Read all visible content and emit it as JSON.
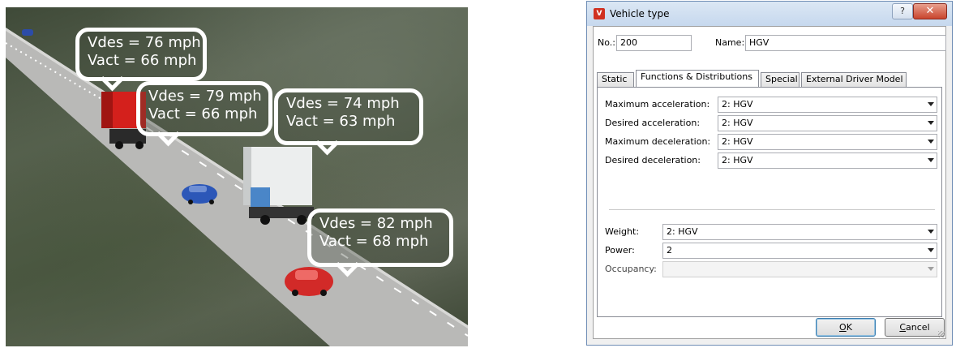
{
  "simulation": {
    "bubbles": [
      {
        "vdes": "Vdes = 76 mph",
        "vact": "Vact = 66 mph"
      },
      {
        "vdes": "Vdes = 79 mph",
        "vact": "Vact = 66 mph"
      },
      {
        "vdes": "Vdes = 74 mph",
        "vact": "Vact = 63 mph"
      },
      {
        "vdes": "Vdes = 82 mph",
        "vact": "Vact = 68 mph"
      }
    ]
  },
  "dialog": {
    "title": "Vehicle type",
    "icon": "app-icon",
    "help_label": "?",
    "close_label": "✕",
    "no_label": "No.:",
    "no_value": "200",
    "name_label": "Name:",
    "name_value": "HGV",
    "tabs": [
      "Static",
      "Functions & Distributions",
      "Special",
      "External Driver Model"
    ],
    "active_tab": "Functions & Distributions",
    "functions": [
      {
        "label": "Maximum acceleration:",
        "value": "2: HGV"
      },
      {
        "label": "Desired acceleration:",
        "value": "2: HGV"
      },
      {
        "label": "Maximum deceleration:",
        "value": "2: HGV"
      },
      {
        "label": "Desired deceleration:",
        "value": "2: HGV"
      }
    ],
    "distributions": [
      {
        "label": "Weight:",
        "value": "2: HGV"
      },
      {
        "label": "Power:",
        "value": "2"
      },
      {
        "label": "Occupancy:",
        "value": ""
      }
    ],
    "ok_mnemonic": "O",
    "ok_rest": "K",
    "cancel_mnemonic": "C",
    "cancel_rest": "ancel"
  }
}
